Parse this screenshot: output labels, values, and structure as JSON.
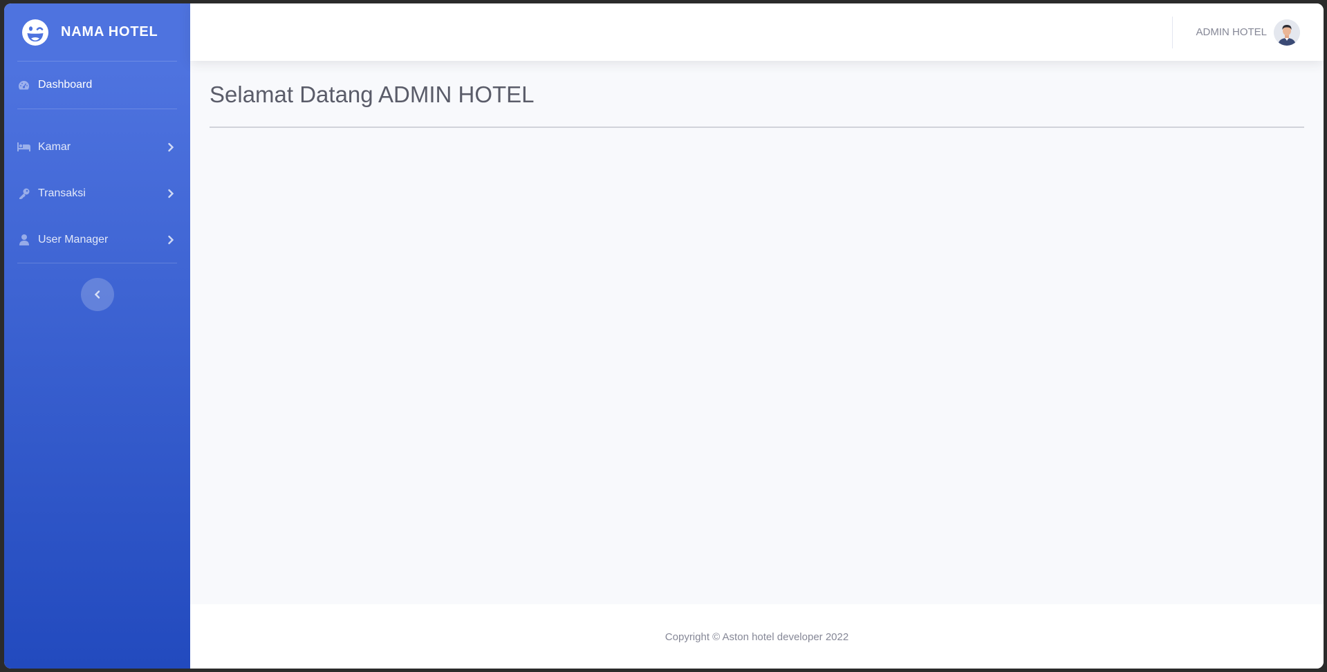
{
  "brand": {
    "name": "NAMA HOTEL",
    "icon": "laugh-wink-icon"
  },
  "sidebar": {
    "items": [
      {
        "label": "Dashboard",
        "icon": "tachometer-icon",
        "has_submenu": false
      },
      {
        "label": "Kamar",
        "icon": "bed-icon",
        "has_submenu": true
      },
      {
        "label": "Transaksi",
        "icon": "key-icon",
        "has_submenu": true
      },
      {
        "label": "User Manager",
        "icon": "user-icon",
        "has_submenu": true
      }
    ],
    "toggle_icon": "chevron-left-icon"
  },
  "topbar": {
    "user_name": "ADMIN HOTEL",
    "avatar_icon": "user-avatar-icon"
  },
  "main": {
    "title": "Selamat Datang ADMIN HOTEL"
  },
  "footer": {
    "text": "Copyright © Aston hotel developer 2022"
  },
  "colors": {
    "sidebar_top": "#4e73df",
    "sidebar_bottom": "#224abe",
    "text_muted": "#858796",
    "title_text": "#5a5c69",
    "content_bg": "#f8f9fc"
  }
}
